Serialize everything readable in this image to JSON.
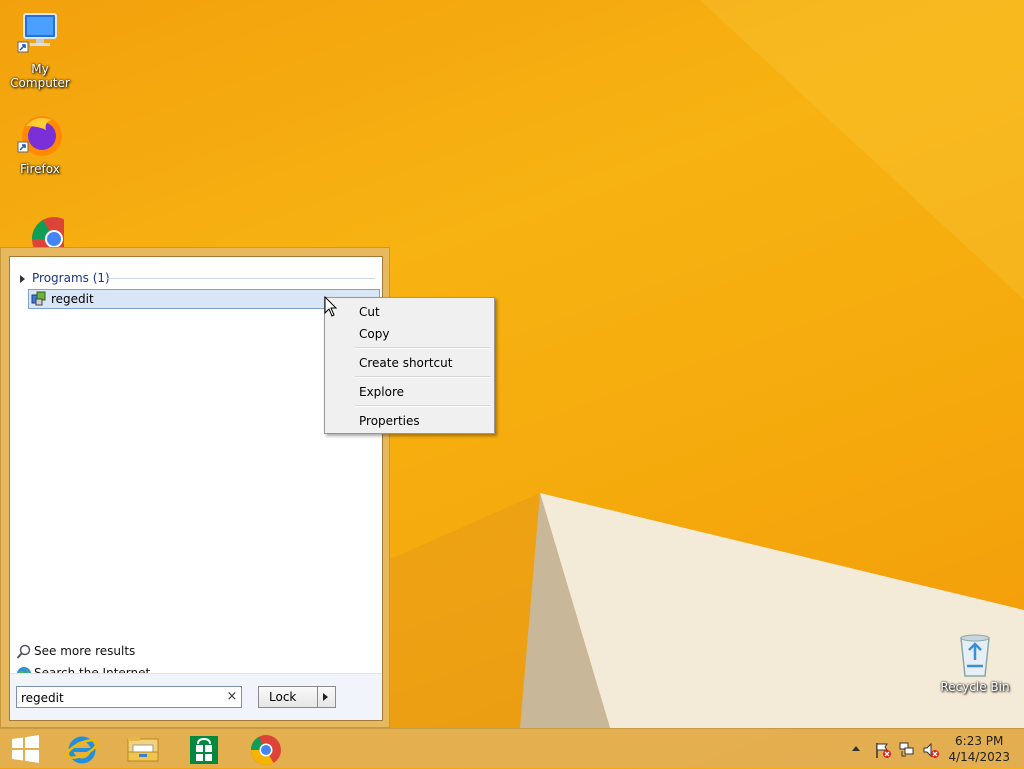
{
  "desktop": {
    "icons": [
      {
        "label": "My Computer",
        "icon": "computer-icon"
      },
      {
        "label": "Firefox",
        "icon": "firefox-icon"
      },
      {
        "label": "",
        "icon": "chrome-icon"
      },
      {
        "label": "Recycle Bin",
        "icon": "recycle-bin-icon"
      }
    ]
  },
  "start_menu": {
    "section_label": "Programs (1)",
    "results": [
      {
        "label": "regedit",
        "icon": "regedit-icon"
      }
    ],
    "see_more_label": "See more results",
    "search_internet_label": "Search the Internet",
    "search": {
      "value": "regedit"
    },
    "clear_glyph": "×",
    "lock_label": "Lock"
  },
  "context_menu": {
    "items": [
      "Cut",
      "Copy",
      "Create shortcut",
      "Explore",
      "Properties"
    ]
  },
  "taskbar": {
    "pinned": [
      "windows-start-icon",
      "internet-explorer-icon",
      "file-explorer-icon",
      "store-icon",
      "chrome-icon"
    ],
    "clock": {
      "time": "6:23 PM",
      "date": "4/14/2023"
    }
  },
  "colors": {
    "wallpaper": "#f5a90c",
    "menu_frame": "#e7b95f",
    "selection": "#d8e6f7"
  }
}
